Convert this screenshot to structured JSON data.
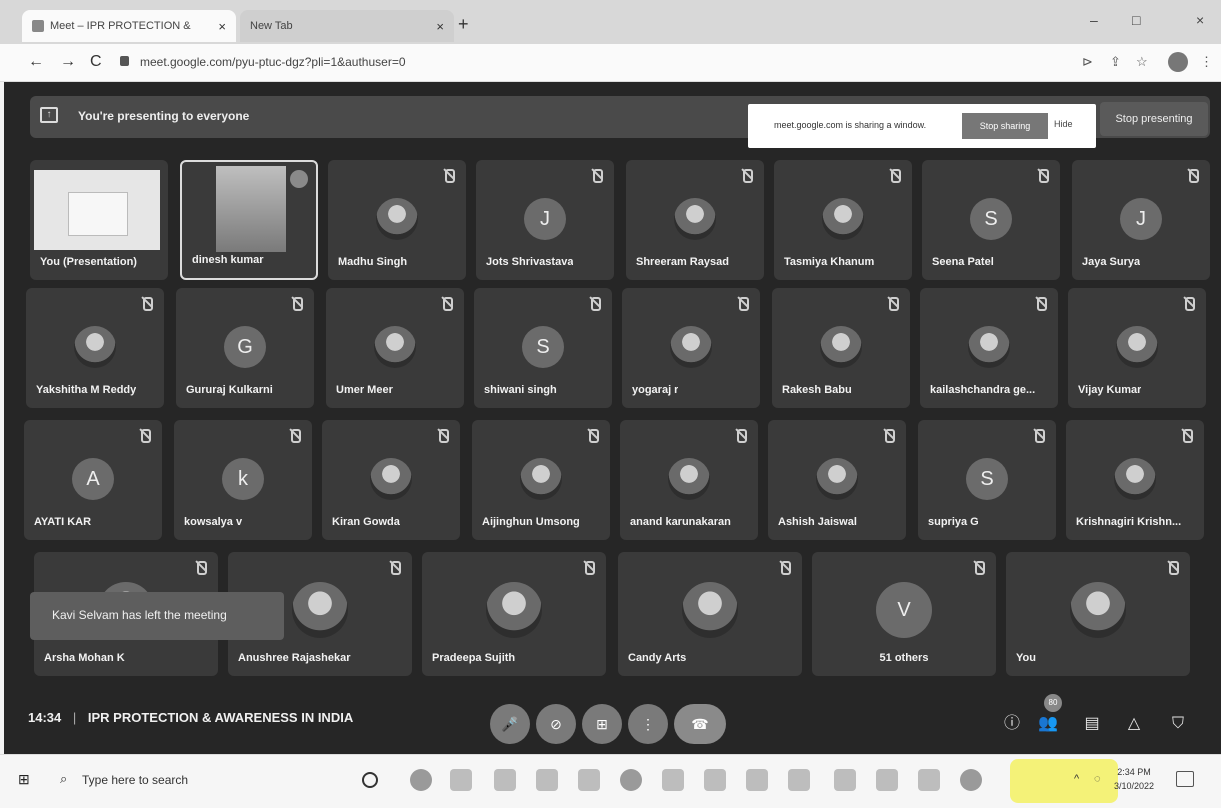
{
  "browser": {
    "tabs": [
      {
        "title": "Meet – IPR PROTECTION &",
        "active": true
      },
      {
        "title": "New Tab",
        "active": false
      }
    ],
    "new_tab_label": "+",
    "url": "meet.google.com/pyu-ptuc-dgz?pli=1&authuser=0",
    "nav": {
      "back": "←",
      "forward": "→",
      "reload": "C"
    },
    "window_controls": {
      "minimize": "–",
      "maximize": "□",
      "close": "×"
    }
  },
  "meet": {
    "presenting_banner": "You're presenting to everyone",
    "share_notice": "meet.google.com is sharing a window.",
    "stop_sharing_label": "Stop sharing",
    "hide_label": "Hide",
    "stop_presenting_label": "Stop presenting",
    "toast": "Kavi Selvam has left the meeting",
    "participants": [
      {
        "name": "You (Presentation)",
        "kind": "presentation"
      },
      {
        "name": "dinesh kumar",
        "kind": "self-cam"
      },
      {
        "name": "Madhu Singh",
        "kind": "photo"
      },
      {
        "name": "Jots Shrivastava",
        "kind": "letter",
        "letter": "J"
      },
      {
        "name": "Shreeram Raysad",
        "kind": "photo"
      },
      {
        "name": "Tasmiya Khanum",
        "kind": "photo"
      },
      {
        "name": "Seena Patel",
        "kind": "letter",
        "letter": "S"
      },
      {
        "name": "Jaya Surya",
        "kind": "letter",
        "letter": "J"
      },
      {
        "name": "Yakshitha M Reddy",
        "kind": "photo"
      },
      {
        "name": "Gururaj Kulkarni",
        "kind": "letter",
        "letter": "G"
      },
      {
        "name": "Umer Meer",
        "kind": "photo"
      },
      {
        "name": "shiwani singh",
        "kind": "letter",
        "letter": "S"
      },
      {
        "name": "yogaraj r",
        "kind": "photo"
      },
      {
        "name": "Rakesh Babu",
        "kind": "photo"
      },
      {
        "name": "kailashchandra ge...",
        "kind": "photo"
      },
      {
        "name": "Vijay Kumar",
        "kind": "photo"
      },
      {
        "name": "AYATI KAR",
        "kind": "letter",
        "letter": "A"
      },
      {
        "name": "kowsalya v",
        "kind": "letter",
        "letter": "k"
      },
      {
        "name": "Kiran Gowda",
        "kind": "photo"
      },
      {
        "name": "Aijinghun Umsong",
        "kind": "photo"
      },
      {
        "name": "anand karunakaran",
        "kind": "photo"
      },
      {
        "name": "Ashish Jaiswal",
        "kind": "photo"
      },
      {
        "name": "supriya G",
        "kind": "letter",
        "letter": "S"
      },
      {
        "name": "Krishnagiri Krishn...",
        "kind": "photo"
      },
      {
        "name": "Arsha Mohan K",
        "kind": "photo"
      },
      {
        "name": "Anushree Rajashekar",
        "kind": "photo"
      },
      {
        "name": "Pradeepa Sujith",
        "kind": "photo"
      },
      {
        "name": "Candy Arts",
        "kind": "photo"
      },
      {
        "name": "51 others",
        "kind": "others",
        "letter": "V"
      },
      {
        "name": "You",
        "kind": "photo"
      }
    ],
    "bottom": {
      "time": "14:34",
      "meeting_title": "IPR PROTECTION & AWARENESS IN INDIA",
      "people_badge": "80"
    }
  },
  "taskbar": {
    "search_placeholder": "Type here to search",
    "clock_time": "2:34 PM",
    "clock_date": "3/10/2022"
  }
}
